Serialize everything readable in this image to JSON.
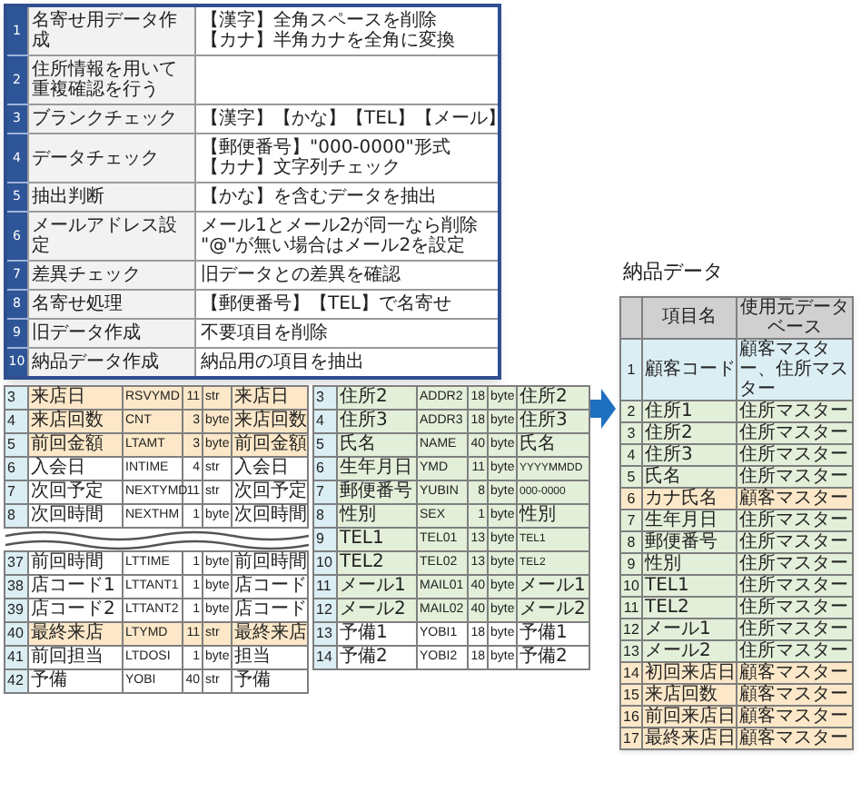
{
  "process_panel": {
    "rows": [
      {
        "no": "1",
        "label": "名寄せ用データ作成",
        "lines": [
          "【漢字】全角スペースを削除",
          "【カナ】半角カナを全角に変換"
        ]
      },
      {
        "no": "2",
        "label": "住所情報を用いて重複確認を行う",
        "lines": []
      },
      {
        "no": "3",
        "label": "ブランクチェック",
        "lines": [
          "【漢字】【かな】【TEL】【メール】"
        ]
      },
      {
        "no": "4",
        "label": "データチェック",
        "lines": [
          "【郵便番号】\"000-0000\"形式",
          "【カナ】文字列チェック"
        ]
      },
      {
        "no": "5",
        "label": "抽出判断",
        "lines": [
          "【かな】を含むデータを抽出"
        ]
      },
      {
        "no": "6",
        "label": "メールアドレス設定",
        "lines": [
          "メール1とメール2が同一なら削除",
          "\"@\"が無い場合はメール2を設定"
        ]
      },
      {
        "no": "7",
        "label": "差異チェック",
        "lines": [
          "旧データとの差異を確認"
        ]
      },
      {
        "no": "8",
        "label": "名寄せ処理",
        "lines": [
          "【郵便番号】【TEL】で名寄せ"
        ]
      },
      {
        "no": "9",
        "label": "旧データ作成",
        "lines": [
          "不要項目を削除"
        ]
      },
      {
        "no": "10",
        "label": "納品データ作成",
        "lines": [
          "納品用の項目を抽出"
        ]
      }
    ]
  },
  "source_table_1": {
    "rows": [
      {
        "no": "3",
        "name": "来店日",
        "field": "RSVYMD",
        "length": "11",
        "type": "str",
        "description": "来店日",
        "color": "#fce8c8"
      },
      {
        "no": "4",
        "name": "来店回数",
        "field": "CNT",
        "length": "3",
        "type": "byte",
        "description": "来店回数",
        "color": "#fce8c8"
      },
      {
        "no": "5",
        "name": "前回金額",
        "field": "LTAMT",
        "length": "3",
        "type": "byte",
        "description": "前回金額",
        "color": "#fce8c8"
      },
      {
        "no": "6",
        "name": "入会日",
        "field": "INTIME",
        "length": "4",
        "type": "str",
        "description": "入会日",
        "color": "#ffffff"
      },
      {
        "no": "7",
        "name": "次回予定",
        "field": "NEXTYMD",
        "length": "11",
        "type": "str",
        "description": "次回予定",
        "color": "#ffffff"
      },
      {
        "no": "8",
        "name": "次回時間",
        "field": "NEXTHM",
        "length": "1",
        "type": "byte",
        "description": "次回時間",
        "color": "#ffffff"
      },
      {
        "no": "37",
        "name": "前回時間",
        "field": "LTTIME",
        "length": "1",
        "type": "byte",
        "description": "前回時間",
        "color": "#ffffff",
        "break_before": true
      },
      {
        "no": "38",
        "name": "店コード1",
        "field": "LTTANT1",
        "length": "1",
        "type": "byte",
        "description": "店コード",
        "color": "#ffffff"
      },
      {
        "no": "39",
        "name": "店コード2",
        "field": "LTTANT2",
        "length": "1",
        "type": "byte",
        "description": "店コード",
        "color": "#ffffff"
      },
      {
        "no": "40",
        "name": "最終来店",
        "field": "LTYMD",
        "length": "11",
        "type": "str",
        "description": "最終来店",
        "color": "#fce8c8"
      },
      {
        "no": "41",
        "name": "前回担当",
        "field": "LTDOSI",
        "length": "1",
        "type": "byte",
        "description": "担当",
        "color": "#ffffff"
      },
      {
        "no": "42",
        "name": "予備",
        "field": "YOBI",
        "length": "40",
        "type": "str",
        "description": "予備",
        "color": "#ffffff"
      }
    ]
  },
  "source_table_2": {
    "rows": [
      {
        "no": "3",
        "name": "住所2",
        "field": "ADDR2",
        "length": "18",
        "type": "byte",
        "description": "住所2",
        "color": "#e3efd9"
      },
      {
        "no": "4",
        "name": "住所3",
        "field": "ADDR3",
        "length": "18",
        "type": "byte",
        "description": "住所3",
        "color": "#e3efd9"
      },
      {
        "no": "5",
        "name": "氏名",
        "field": "NAME",
        "length": "40",
        "type": "byte",
        "description": "氏名",
        "color": "#e3efd9"
      },
      {
        "no": "6",
        "name": "生年月日",
        "field": "YMD",
        "length": "11",
        "type": "byte",
        "description": "YYYYMMDD",
        "color": "#e3efd9"
      },
      {
        "no": "7",
        "name": "郵便番号",
        "field": "YUBIN",
        "length": "8",
        "type": "byte",
        "description": "000-0000",
        "color": "#e3efd9"
      },
      {
        "no": "8",
        "name": "性別",
        "field": "SEX",
        "length": "1",
        "type": "byte",
        "description": "性別",
        "color": "#e3efd9"
      },
      {
        "no": "9",
        "name": "TEL1",
        "field": "TEL01",
        "length": "13",
        "type": "byte",
        "description": "TEL1",
        "color": "#e3efd9"
      },
      {
        "no": "10",
        "name": "TEL2",
        "field": "TEL02",
        "length": "13",
        "type": "byte",
        "description": "TEL2",
        "color": "#e3efd9"
      },
      {
        "no": "11",
        "name": "メール1",
        "field": "MAIL01",
        "length": "40",
        "type": "byte",
        "description": "メール1",
        "color": "#e3efd9"
      },
      {
        "no": "12",
        "name": "メール2",
        "field": "MAIL02",
        "length": "40",
        "type": "byte",
        "description": "メール2",
        "color": "#e3efd9"
      },
      {
        "no": "13",
        "name": "予備1",
        "field": "YOBI1",
        "length": "18",
        "type": "byte",
        "description": "予備1",
        "color": "#ffffff"
      },
      {
        "no": "14",
        "name": "予備2",
        "field": "YOBI2",
        "length": "18",
        "type": "byte",
        "description": "予備2",
        "color": "#ffffff"
      }
    ]
  },
  "delivery": {
    "title": "納品データ",
    "columns": [
      "項目名",
      "使用元データベース"
    ],
    "rows": [
      {
        "no": "1",
        "name": "顧客コード",
        "database": "顧客マスター、住所マスター",
        "color": "#dbeef4"
      },
      {
        "no": "2",
        "name": "住所1",
        "database": "住所マスター",
        "color": "#e3efd9"
      },
      {
        "no": "3",
        "name": "住所2",
        "database": "住所マスター",
        "color": "#e3efd9"
      },
      {
        "no": "4",
        "name": "住所3",
        "database": "住所マスター",
        "color": "#e3efd9"
      },
      {
        "no": "5",
        "name": "氏名",
        "database": "住所マスター",
        "color": "#e3efd9"
      },
      {
        "no": "6",
        "name": "カナ氏名",
        "database": "顧客マスター",
        "color": "#fce8c8"
      },
      {
        "no": "7",
        "name": "生年月日",
        "database": "住所マスター",
        "color": "#e3efd9"
      },
      {
        "no": "8",
        "name": "郵便番号",
        "database": "住所マスター",
        "color": "#e3efd9"
      },
      {
        "no": "9",
        "name": "性別",
        "database": "住所マスター",
        "color": "#e3efd9"
      },
      {
        "no": "10",
        "name": "TEL1",
        "database": "住所マスター",
        "color": "#e3efd9"
      },
      {
        "no": "11",
        "name": "TEL2",
        "database": "住所マスター",
        "color": "#e3efd9"
      },
      {
        "no": "12",
        "name": "メール1",
        "database": "住所マスター",
        "color": "#e3efd9"
      },
      {
        "no": "13",
        "name": "メール2",
        "database": "住所マスター",
        "color": "#e3efd9"
      },
      {
        "no": "14",
        "name": "初回来店日",
        "database": "顧客マスター",
        "color": "#fce8c8"
      },
      {
        "no": "15",
        "name": "来店回数",
        "database": "顧客マスター",
        "color": "#fce8c8"
      },
      {
        "no": "16",
        "name": "前回来店日",
        "database": "顧客マスター",
        "color": "#fce8c8"
      },
      {
        "no": "17",
        "name": "最終来店日",
        "database": "顧客マスター",
        "color": "#fce8c8"
      }
    ]
  }
}
